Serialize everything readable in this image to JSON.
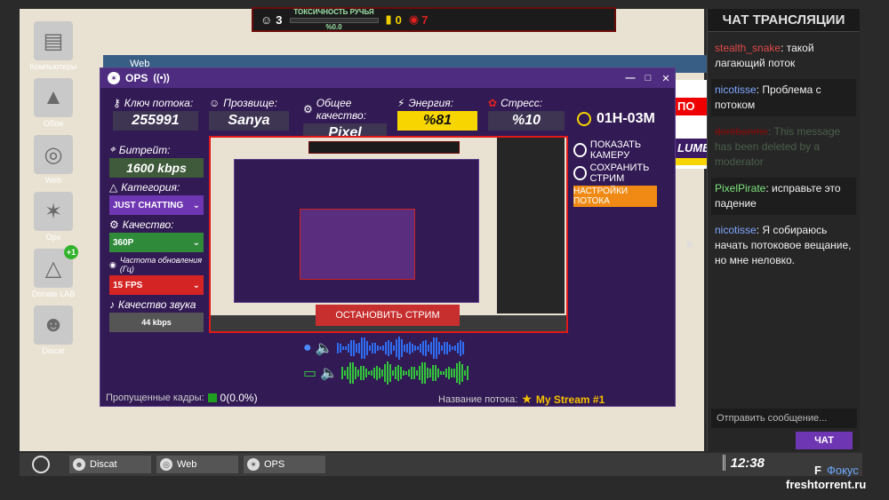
{
  "hud": {
    "viewers": "3",
    "toxicity_label": "ТОКСИЧНОСТЬ РУЧЬЯ",
    "toxicity_value": "%0.0",
    "money": "0",
    "eye_value": "7"
  },
  "desktop_icons": [
    {
      "label": "Компьютеры",
      "icon": "computer-icon"
    },
    {
      "label": "Обои",
      "icon": "wallpaper-icon"
    },
    {
      "label": "Web",
      "icon": "globe-icon"
    },
    {
      "label": "Ops",
      "icon": "ops-icon"
    },
    {
      "label": "Donate LAB",
      "icon": "flask-icon",
      "badge": "+1"
    },
    {
      "label": "Discat",
      "icon": "cat-icon"
    }
  ],
  "web_window": {
    "title": "Web"
  },
  "ops": {
    "title": "OPS",
    "stream_key_label": "Ключ потока:",
    "stream_key": "255991",
    "nickname_label": "Прозвище:",
    "nickname": "Sanya",
    "quality_label": "Общее качество:",
    "quality": "Pixel",
    "energy_label": "Энергия:",
    "energy": "%81",
    "stress_label": "Стресс:",
    "stress": "%10",
    "timer": "01H-03M",
    "bitrate_label": "Битрейт:",
    "bitrate": "1600 kbps",
    "category_label": "Категория:",
    "category": "JUST CHATTING",
    "video_quality_label": "Качество:",
    "video_quality": "360P",
    "fps_label": "Частота обновления (Гц)",
    "fps": "15 FPS",
    "audio_label": "Качество звука",
    "audio": "44 kbps",
    "show_camera": "ПОКАЗАТЬ КАМЕРУ",
    "save_stream": "СОХРАНИТЬ СТРИМ",
    "stream_settings": "НАСТРОЙКИ ПОТОКА",
    "stop_stream": "ОСТАНОВИТЬ СТРИМ",
    "dropped_label": "Пропущенные кадры:",
    "dropped_value": "0(0.0%)",
    "stream_name_label": "Название потока:",
    "stream_name": "My Stream #1"
  },
  "chat": {
    "title": "ЧАТ ТРАНСЛЯЦИИ",
    "messages": [
      {
        "nick": "stealth_snake",
        "text": ": такой лагающий поток",
        "color": "#e04848"
      },
      {
        "nick": "nicotisse",
        "text": ": Проблема с потоком",
        "color": "#7fa6ff"
      },
      {
        "nick": "dontbanme",
        "text": ": This message has been deleted by a moderator",
        "color": "#7a0f0f",
        "deleted": true
      },
      {
        "nick": "PixelPirate",
        "text": ": исправьте это падение",
        "color": "#7ce27c"
      },
      {
        "nick": "nicotisse",
        "text": ": Я собираюсь начать потоковое вещание, но мне неловко.",
        "color": "#7fa6ff"
      }
    ],
    "input_placeholder": "Отправить сообщение...",
    "send_label": "ЧАТ"
  },
  "taskbar": {
    "tasks": [
      {
        "label": "Discat"
      },
      {
        "label": "Web"
      },
      {
        "label": "OPS"
      }
    ],
    "clock": "12:38"
  },
  "focus": {
    "key": "F",
    "label": "Фокус"
  },
  "watermark": "freshtorrent.ru",
  "colors": {
    "ops_bg": "#321a54",
    "accent_purple": "#6e36b2",
    "record_red": "#e01a1a",
    "energy_yellow": "#f6d500",
    "settings_orange": "#f08a14"
  }
}
